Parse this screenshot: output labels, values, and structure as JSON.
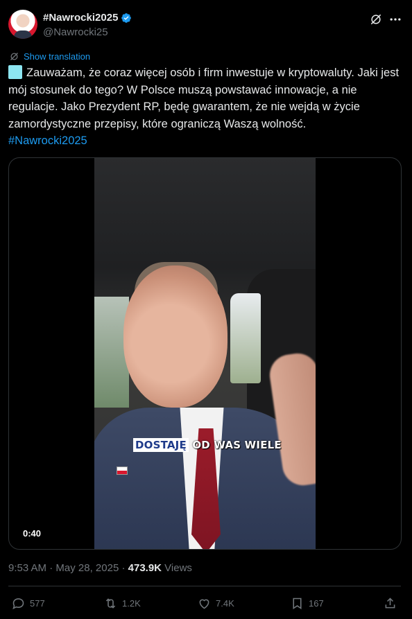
{
  "author": {
    "display_name": "#Nawrocki2025",
    "handle": "@Nawrocki25",
    "verified": true
  },
  "translate_label": "Show translation",
  "tweet": {
    "text": "Zauważam, że coraz więcej osób i firm inwestuje w kryptowaluty. Jaki jest mój stosunek do tego? W Polsce muszą powstawać innowacje, a nie regulacje. Jako Prezydent RP, będę gwarantem, że nie wejdą w życie zamordystyczne przepisy, które ograniczą Waszą wolność.",
    "hashtag": "#Nawrocki2025"
  },
  "video": {
    "caption_highlight": "DOSTAJĘ",
    "caption_rest": " OD WAS WIELE",
    "duration": "0:40"
  },
  "meta": {
    "time": "9:53 AM",
    "separator": " · ",
    "date": "May 28, 2025",
    "views_count": "473.9K",
    "views_label": " Views"
  },
  "actions": {
    "replies": "577",
    "reposts": "1.2K",
    "likes": "7.4K",
    "bookmarks": "167"
  },
  "colors": {
    "accent": "#1d9bf0",
    "background": "#000000",
    "text": "#e7e9ea",
    "muted": "#71767b"
  }
}
